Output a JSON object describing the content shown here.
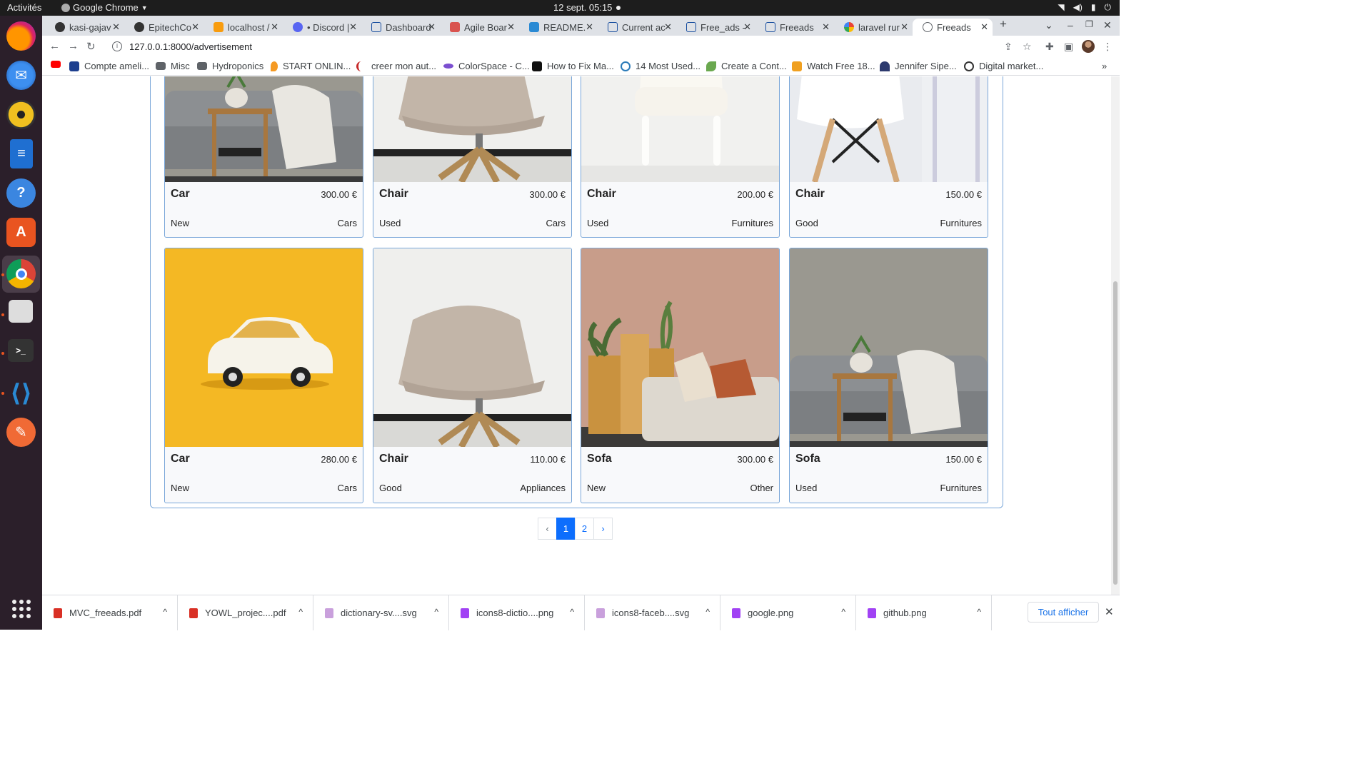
{
  "os": {
    "activities": "Activités",
    "app_name": "Google Chrome",
    "clock": "12 sept.  05:15"
  },
  "browser": {
    "tabs": [
      {
        "label": "kasi-gajav",
        "icon": "github-icon"
      },
      {
        "label": "EpitechCo",
        "icon": "github-icon"
      },
      {
        "label": "localhost /",
        "icon": "phpmyadmin-icon"
      },
      {
        "label": "• Discord |",
        "icon": "discord-icon"
      },
      {
        "label": "Dashboard",
        "icon": "bracket-icon"
      },
      {
        "label": "Agile Boar",
        "icon": "trello-icon"
      },
      {
        "label": "README.",
        "icon": "vscode-icon"
      },
      {
        "label": "Current ac",
        "icon": "bracket-icon"
      },
      {
        "label": "Free_ads -",
        "icon": "bracket-icon"
      },
      {
        "label": "Freeads",
        "icon": "bracket-icon"
      },
      {
        "label": "laravel rur",
        "icon": "google-icon"
      },
      {
        "label": "Freeads",
        "icon": "globe-icon",
        "active": true
      }
    ],
    "url": "127.0.0.1:8000/advertisement",
    "bookmarks": [
      {
        "label": "",
        "icon": "youtube-icon"
      },
      {
        "label": "Compte ameli...",
        "icon": "ameli-icon"
      },
      {
        "label": "Misc",
        "icon": "folder-icon"
      },
      {
        "label": "Hydroponics",
        "icon": "folder-icon"
      },
      {
        "label": "START ONLIN...",
        "icon": "flame-icon"
      },
      {
        "label": "creer mon aut...",
        "icon": "swoosh-icon"
      },
      {
        "label": "ColorSpace - C...",
        "icon": "colorspace-icon"
      },
      {
        "label": "How to Fix Ma...",
        "icon": "tm-icon"
      },
      {
        "label": "14 Most Used...",
        "icon": "circle-icon"
      },
      {
        "label": "Create a Cont...",
        "icon": "leaf-icon"
      },
      {
        "label": "Watch Free 18...",
        "icon": "hd-icon"
      },
      {
        "label": "Jennifer Sipe...",
        "icon": "person-icon"
      },
      {
        "label": "Digital market...",
        "icon": "clock-icon"
      }
    ]
  },
  "ads": [
    {
      "title": "Car",
      "price": "300.00 €",
      "state": "New",
      "category": "Cars",
      "image": "sofa-photo"
    },
    {
      "title": "Chair",
      "price": "300.00 €",
      "state": "Used",
      "category": "Cars",
      "image": "beige-chair-photo"
    },
    {
      "title": "Chair",
      "price": "200.00 €",
      "state": "Used",
      "category": "Furnitures",
      "image": "white-armchair-photo"
    },
    {
      "title": "Chair",
      "price": "150.00 €",
      "state": "Good",
      "category": "Furnitures",
      "image": "white-plastic-chair-photo"
    },
    {
      "title": "Car",
      "price": "280.00 €",
      "state": "New",
      "category": "Cars",
      "image": "toy-car-photo"
    },
    {
      "title": "Chair",
      "price": "110.00 €",
      "state": "Good",
      "category": "Appliances",
      "image": "beige-chair-photo"
    },
    {
      "title": "Sofa",
      "price": "300.00 €",
      "state": "New",
      "category": "Other",
      "image": "sofa-plants-photo"
    },
    {
      "title": "Sofa",
      "price": "150.00 €",
      "state": "Used",
      "category": "Furnitures",
      "image": "sofa-photo"
    }
  ],
  "pagination": {
    "prev": "‹",
    "pages": [
      "1",
      "2"
    ],
    "current": "1",
    "next": "›"
  },
  "downloads": [
    {
      "name": "MVC_freeads.pdf",
      "type": "pdf"
    },
    {
      "name": "YOWL_projec....pdf",
      "type": "pdf"
    },
    {
      "name": "dictionary-sv....svg",
      "type": "svg"
    },
    {
      "name": "icons8-dictio....png",
      "type": "png"
    },
    {
      "name": "icons8-faceb....svg",
      "type": "svg"
    },
    {
      "name": "google.png",
      "type": "png"
    },
    {
      "name": "github.png",
      "type": "png"
    }
  ],
  "show_all": "Tout afficher"
}
